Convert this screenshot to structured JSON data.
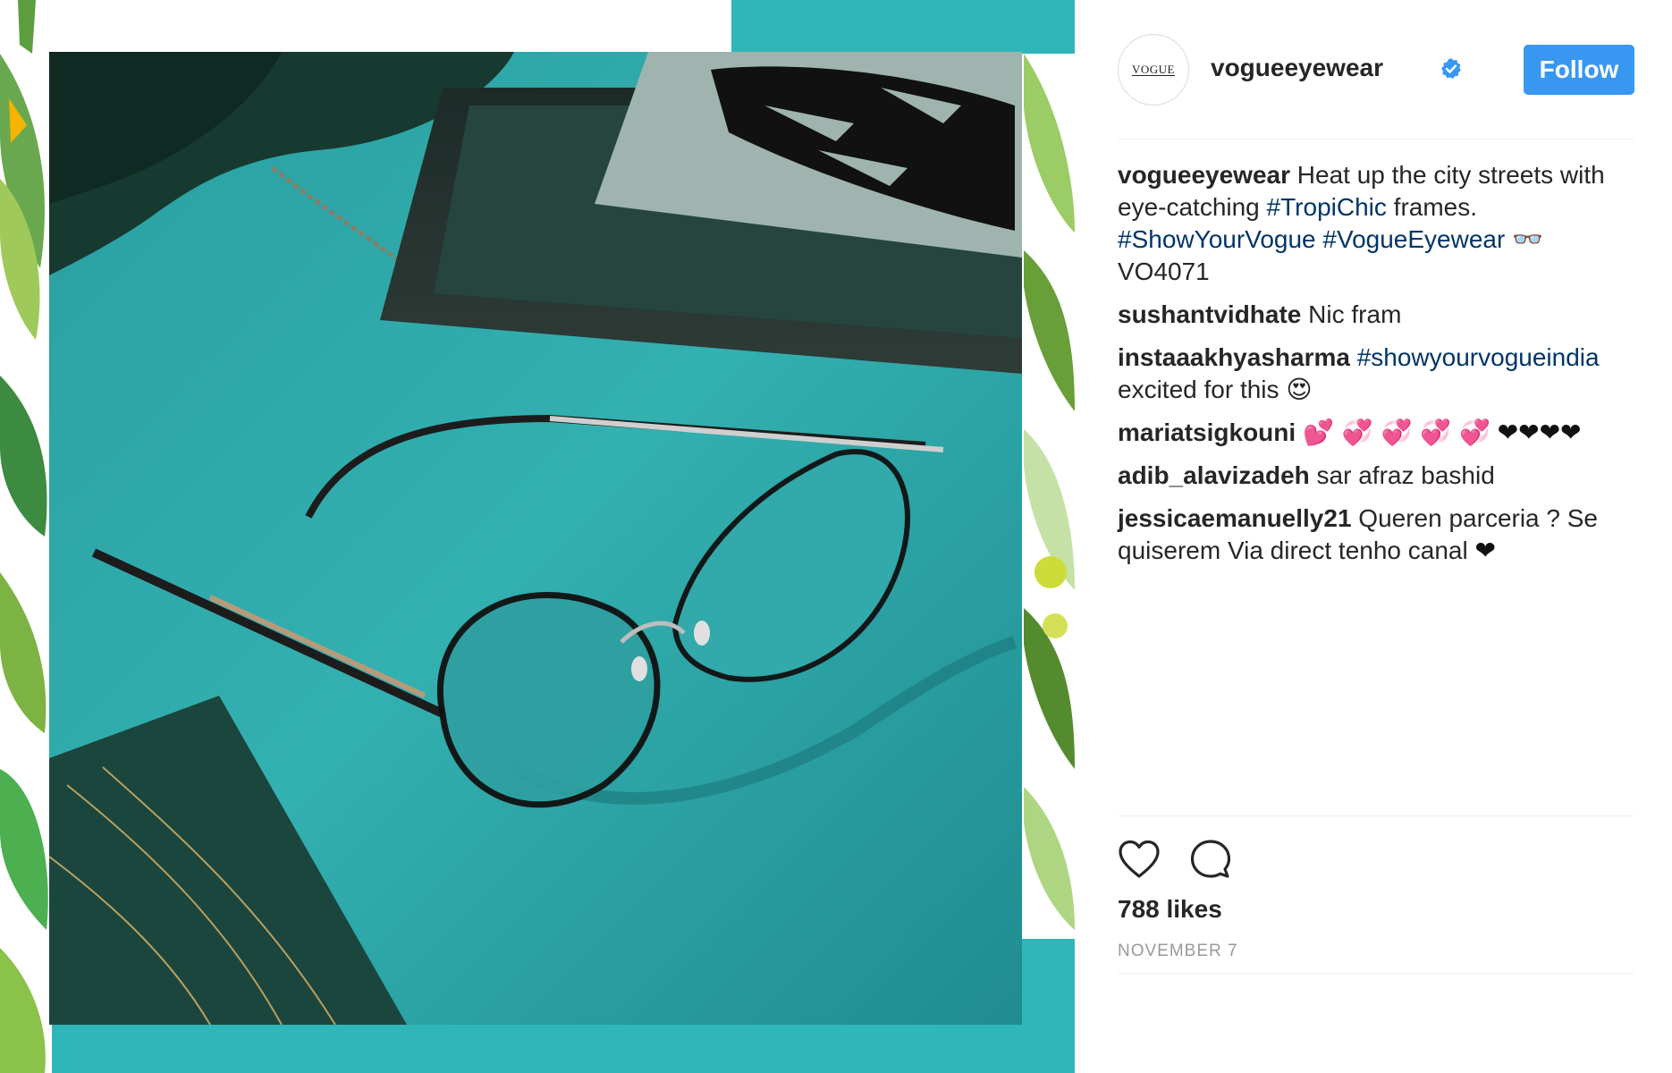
{
  "post": {
    "username": "vogueeyewear",
    "avatar_text": "VOGUE",
    "follow_label": "Follow",
    "likes": "788 likes",
    "date": "NOVEMBER 7"
  },
  "caption": {
    "author": "vogueeyewear",
    "text_1": "Heat up the city streets with eye-catching ",
    "tag_1": "#TropiChic",
    "text_2": " frames. ",
    "tag_2": "#ShowYourVogue",
    "tag_3": "#VogueEyewear",
    "emoji": "👓",
    "text_3": "VO4071"
  },
  "comments": [
    {
      "author": "sushantvidhate",
      "text": "Nic fram"
    },
    {
      "author": "instaaakhyasharma",
      "tag": "#showyourvogueindia",
      "text": "excited for this",
      "emoji": "😍"
    },
    {
      "author": "mariatsigkouni",
      "pink": "💕 💞 💞 💞 💞",
      "black": "❤❤❤❤"
    },
    {
      "author": "adib_alavizadeh",
      "text": "sar afraz bashid"
    },
    {
      "author": "jessicaemanuelly21",
      "text": "Queren parceria ? Se quiserem Via direct tenho canal",
      "emoji": "❤"
    }
  ],
  "icons": {
    "verified": "verified-badge-icon",
    "like": "heart-outline-icon",
    "comment": "speech-bubble-icon"
  },
  "colors": {
    "follow_button": "#3897f0",
    "hashtag": "#003569",
    "teal": "#2fb6b8",
    "date": "#999999"
  }
}
